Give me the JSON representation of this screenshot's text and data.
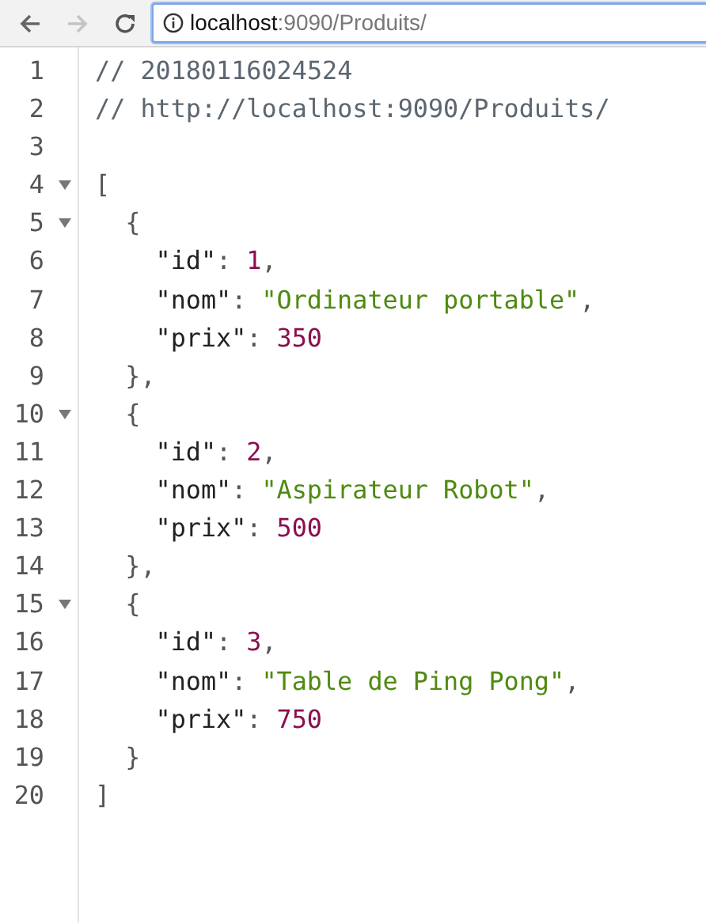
{
  "toolbar": {
    "back": {
      "disabled": false
    },
    "forward": {
      "disabled": true
    },
    "address": {
      "host": "localhost",
      "rest": ":9090/Produits/",
      "focused": true
    }
  },
  "lines": [
    {
      "number": "1",
      "foldable": false,
      "tokens": [
        {
          "kind": "comment",
          "text": "// 20180116024524"
        }
      ]
    },
    {
      "number": "2",
      "foldable": false,
      "tokens": [
        {
          "kind": "comment",
          "text": "// http://localhost:9090/Produits/"
        }
      ]
    },
    {
      "number": "3",
      "foldable": false
    },
    {
      "number": "4",
      "foldable": true,
      "tokens": [
        {
          "kind": "punct",
          "text": "["
        }
      ]
    },
    {
      "number": "5",
      "foldable": true,
      "tokens": [
        {
          "kind": "punct",
          "text": "  {"
        }
      ]
    },
    {
      "number": "6",
      "foldable": false,
      "tokens": [
        {
          "kind": "key",
          "text": "    \"id\""
        },
        {
          "kind": "punct",
          "text": ":"
        },
        {
          "kind": "number",
          "text": "1"
        },
        {
          "kind": "punct",
          "text": ","
        }
      ]
    },
    {
      "number": "7",
      "foldable": false,
      "tokens": [
        {
          "kind": "key",
          "text": "    \"nom\""
        },
        {
          "kind": "punct",
          "text": ":"
        },
        {
          "kind": "string",
          "text": "\"Ordinateur portable\""
        },
        {
          "kind": "punct",
          "text": ","
        }
      ]
    },
    {
      "number": "8",
      "foldable": false,
      "tokens": [
        {
          "kind": "key",
          "text": "    \"prix\""
        },
        {
          "kind": "punct",
          "text": ":"
        },
        {
          "kind": "number",
          "text": "350"
        }
      ]
    },
    {
      "number": "9",
      "foldable": false,
      "tokens": [
        {
          "kind": "punct",
          "text": "  },"
        }
      ]
    },
    {
      "number": "10",
      "foldable": true,
      "tokens": [
        {
          "kind": "punct",
          "text": "  {"
        }
      ]
    },
    {
      "number": "11",
      "foldable": false,
      "tokens": [
        {
          "kind": "key",
          "text": "    \"id\""
        },
        {
          "kind": "punct",
          "text": ":"
        },
        {
          "kind": "number",
          "text": "2"
        },
        {
          "kind": "punct",
          "text": ","
        }
      ]
    },
    {
      "number": "12",
      "foldable": false,
      "tokens": [
        {
          "kind": "key",
          "text": "    \"nom\""
        },
        {
          "kind": "punct",
          "text": ":"
        },
        {
          "kind": "string",
          "text": "\"Aspirateur Robot\""
        },
        {
          "kind": "punct",
          "text": ","
        }
      ]
    },
    {
      "number": "13",
      "foldable": false,
      "tokens": [
        {
          "kind": "key",
          "text": "    \"prix\""
        },
        {
          "kind": "punct",
          "text": ":"
        },
        {
          "kind": "number",
          "text": "500"
        }
      ]
    },
    {
      "number": "14",
      "foldable": false,
      "tokens": [
        {
          "kind": "punct",
          "text": "  },"
        }
      ]
    },
    {
      "number": "15",
      "foldable": true,
      "tokens": [
        {
          "kind": "punct",
          "text": "  {"
        }
      ]
    },
    {
      "number": "16",
      "foldable": false,
      "tokens": [
        {
          "kind": "key",
          "text": "    \"id\""
        },
        {
          "kind": "punct",
          "text": ":"
        },
        {
          "kind": "number",
          "text": "3"
        },
        {
          "kind": "punct",
          "text": ","
        }
      ]
    },
    {
      "number": "17",
      "foldable": false,
      "tokens": [
        {
          "kind": "key",
          "text": "    \"nom\""
        },
        {
          "kind": "punct",
          "text": ":"
        },
        {
          "kind": "string",
          "text": "\"Table de Ping Pong\""
        },
        {
          "kind": "punct",
          "text": ","
        }
      ]
    },
    {
      "number": "18",
      "foldable": false,
      "tokens": [
        {
          "kind": "key",
          "text": "    \"prix\""
        },
        {
          "kind": "punct",
          "text": ":"
        },
        {
          "kind": "number",
          "text": "750"
        }
      ]
    },
    {
      "number": "19",
      "foldable": false,
      "tokens": [
        {
          "kind": "punct",
          "text": "  }"
        }
      ]
    },
    {
      "number": "20",
      "foldable": false,
      "tokens": [
        {
          "kind": "punct",
          "text": "]"
        }
      ]
    }
  ]
}
